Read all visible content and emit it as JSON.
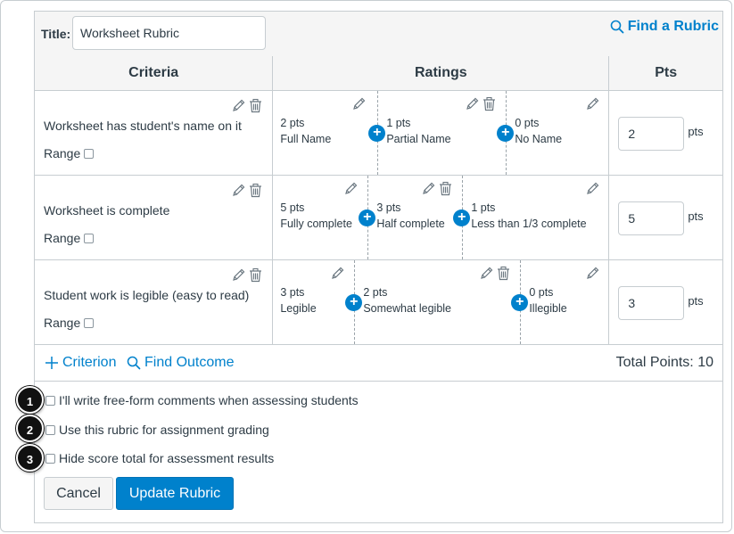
{
  "header": {
    "title_label": "Title:",
    "title_value": "Worksheet Rubric",
    "find_rubric": "Find a Rubric"
  },
  "columns": {
    "criteria": "Criteria",
    "ratings": "Ratings",
    "pts": "Pts"
  },
  "range_label": "Range",
  "pts_unit": "pts",
  "criteria": [
    {
      "description": "Worksheet has student's name on it",
      "points": "2",
      "ratings": [
        {
          "pts": "2 pts",
          "desc": "Full Name"
        },
        {
          "pts": "1 pts",
          "desc": "Partial Name"
        },
        {
          "pts": "0 pts",
          "desc": "No Name"
        }
      ]
    },
    {
      "description": "Worksheet is complete",
      "points": "5",
      "ratings": [
        {
          "pts": "5 pts",
          "desc": "Fully complete"
        },
        {
          "pts": "3 pts",
          "desc": "Half complete"
        },
        {
          "pts": "1 pts",
          "desc": "Less than 1/3 complete"
        }
      ]
    },
    {
      "description": "Student work is legible (easy to read)",
      "points": "3",
      "ratings": [
        {
          "pts": "3 pts",
          "desc": "Legible"
        },
        {
          "pts": "2 pts",
          "desc": "Somewhat legible"
        },
        {
          "pts": "0 pts",
          "desc": "Illegible"
        }
      ]
    }
  ],
  "footer": {
    "add_criterion": "Criterion",
    "find_outcome": "Find Outcome",
    "total_points": "Total Points: 10"
  },
  "options": [
    {
      "badge": "1",
      "label": "I'll write free-form comments when assessing students"
    },
    {
      "badge": "2",
      "label": "Use this rubric for assignment grading"
    },
    {
      "badge": "3",
      "label": "Hide score total for assessment results"
    }
  ],
  "buttons": {
    "cancel": "Cancel",
    "update": "Update Rubric"
  },
  "colors": {
    "accent": "#0081cc",
    "text": "#2d3b45",
    "border": "#c7cdd1",
    "header_bg": "#f5f5f5",
    "badge": "#111111"
  },
  "icons": {
    "edit": "pencil-icon",
    "delete": "trash-icon",
    "add_rating": "plus-circle-icon",
    "search": "magnifier-icon",
    "add": "plus-icon"
  }
}
